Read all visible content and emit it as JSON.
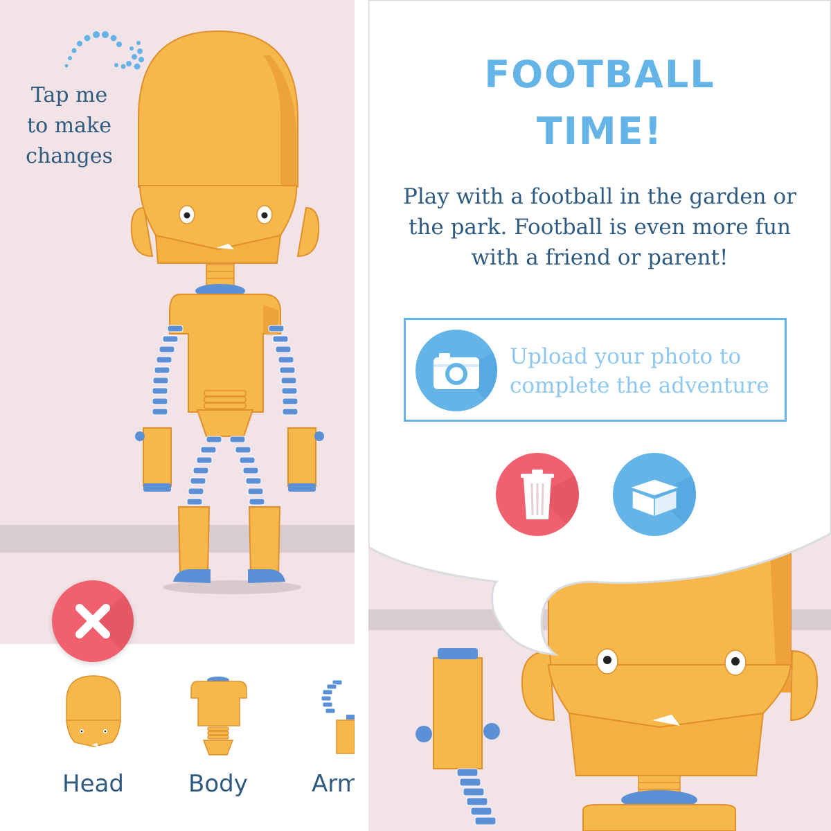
{
  "hint": {
    "text": "Tap me\nto make\nchanges"
  },
  "parts_tray": {
    "items": [
      {
        "label": "Head"
      },
      {
        "label": "Body"
      },
      {
        "label": "Arms"
      }
    ]
  },
  "activity": {
    "title_line1": "FOOTBALL",
    "title_line2": "TIME!",
    "description": "Play with a football in the garden or the park. Football is even more fun with a friend or parent!",
    "upload_text": "Upload your photo to complete the adventure"
  },
  "icons": {
    "close": "close-icon",
    "camera": "camera-icon",
    "trash": "trash-icon",
    "box": "box-icon"
  },
  "colors": {
    "background": "#f1e3e6",
    "robot_body": "#f6b84a",
    "robot_joints": "#5b8fd6",
    "accent_blue": "#64b4e8",
    "text_blue": "#2f5a80",
    "close_red": "#f0606e"
  }
}
